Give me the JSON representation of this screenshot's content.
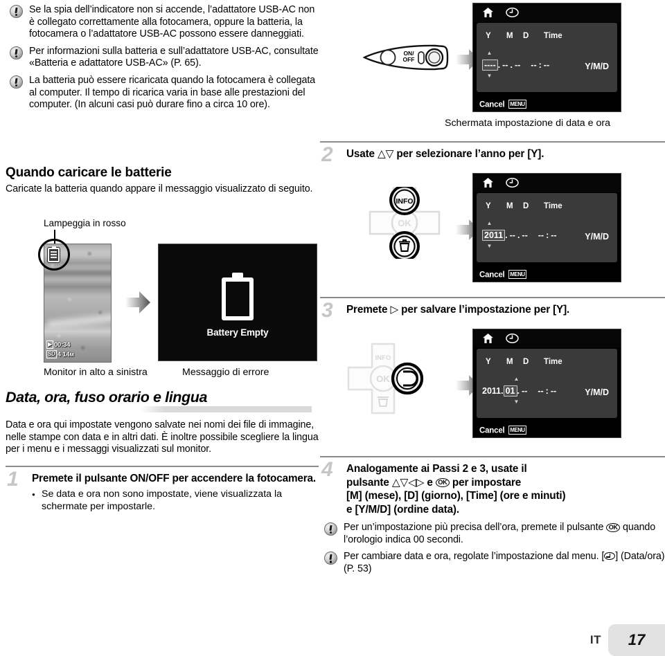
{
  "left_column": {
    "notes_top": [
      {
        "text": "Se la spia dell’indicatore non si accende, l’adattatore USB-AC non è collegato correttamente alla fotocamera, oppure la batteria, la fotocamera o l’adattatore USB-AC possono essere danneggiati."
      },
      {
        "text": "Per informazioni sulla batteria e sull’adattatore USB-AC, consultate «Batteria e adattatore USB-AC» (P. 65)."
      },
      {
        "text": "La batteria può essere ricaricata quando la fotocamera è collegata al computer. Il tempo di ricarica varia in base alle prestazioni del computer. (In alcuni casi può durare fino a circa 10 ore)."
      }
    ],
    "charge_heading": "Quando caricare le batterie",
    "charge_body": "Caricate la batteria quando appare il messaggio visualizzato di seguito.",
    "lamp_label": "Lampeggia in rosso",
    "lcd_photo": {
      "timer": "00:34",
      "shots": "4",
      "resolution": "14",
      "resolution_unit": "M",
      "card_chip": "SD",
      "movie_chip": "▶"
    },
    "error_screen": {
      "message": "Battery Empty"
    },
    "caption_monitor": "Monitor in alto a sinistra",
    "caption_error": "Messaggio di errore",
    "banner_heading": "Data, ora, fuso orario e lingua",
    "banner_body": "Data e ora qui impostate vengono salvate nei nomi dei file di immagine, nelle stampe con data e in altri dati. È inoltre possibile scegliere la lingua per i menu e i messaggi visualizzati sul monitor.",
    "step1": {
      "number": "1",
      "text": "Premete il pulsante ON/OFF per accendere la fotocamera.",
      "sub": "Se data e ora non sono impostate, viene visualizzata la schermate per impostarle."
    }
  },
  "right_column": {
    "power_button": {
      "label_on": "ON/",
      "label_off": "OFF"
    },
    "screen1": {
      "header_y": "Y",
      "header_m": "M",
      "header_d": "D",
      "header_time": "Time",
      "year": "----",
      "month": "--",
      "day": "--",
      "hour": "--",
      "minute": "--",
      "order": "Y/M/D",
      "cancel": "Cancel",
      "menu_chip": "MENU",
      "caption": "Schermata impostazione di data e ora"
    },
    "step2": {
      "number": "2",
      "text_before": "Usate",
      "text_after": "per selezionare l’anno per [Y]."
    },
    "screen2": {
      "header_y": "Y",
      "header_m": "M",
      "header_d": "D",
      "header_time": "Time",
      "year": "2011",
      "month": "--",
      "day": "--",
      "hour": "--",
      "minute": "--",
      "order": "Y/M/D",
      "cancel": "Cancel",
      "menu_chip": "MENU"
    },
    "dpad2": {
      "info": "INFO",
      "ok": "OK"
    },
    "step3": {
      "number": "3",
      "text_before": "Premete",
      "text_after": "per salvare l’impostazione per [Y]."
    },
    "screen3": {
      "header_y": "Y",
      "header_m": "M",
      "header_d": "D",
      "header_time": "Time",
      "year": "2011",
      "month": "01",
      "day": "--",
      "hour": "--",
      "minute": "--",
      "order": "Y/M/D",
      "cancel": "Cancel",
      "menu_chip": "MENU"
    },
    "dpad3": {
      "info": "INFO",
      "ok": "OK"
    },
    "step4": {
      "number": "4",
      "line1": "Analogamente ai Passi 2 e 3, usate il",
      "line2_before": "pulsante",
      "line2_mid": "e",
      "line2_after": "per impostare",
      "line3": "[M] (mese), [D] (giorno), [Time] (ore e minuti)",
      "line4": "e [Y/M/D] (ordine data)."
    },
    "notes_bottom": [
      {
        "before": "Per un’impostazione più precisa dell’ora, premete il pulsante",
        "after": "quando l’orologio indica 00 secondi."
      },
      {
        "before": "Per cambiare data e ora, regolate l’impostazione dal menu. [",
        "after": "] (Data/ora) (P. 53)"
      }
    ]
  },
  "footer": {
    "language": "IT",
    "page_number": "17"
  },
  "colors": {
    "rule": "#8c8c8c",
    "step_number": "#c6c6c6",
    "banner_bar": "#d9d9d9",
    "lcd_panel": "#3a3a3a",
    "footer_box": "#e2e2e2"
  }
}
